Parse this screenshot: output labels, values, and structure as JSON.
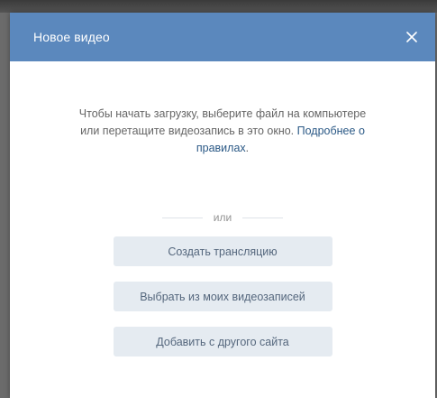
{
  "modal": {
    "title": "Новое видео",
    "close_icon": "close-icon",
    "description_text": "Чтобы начать загрузку, выберите файл на компьютере или перетащите видеозапись в это окно. ",
    "rules_link": "Подробнее о правилах",
    "description_end": ".",
    "divider_text": "или",
    "buttons": [
      {
        "label": "Создать трансляцию"
      },
      {
        "label": "Выбрать из моих видеозаписей"
      },
      {
        "label": "Добавить с другого сайта"
      }
    ]
  },
  "colors": {
    "header": "#5b88bd",
    "button_bg": "#e5ebf1",
    "button_text": "#55677d",
    "link": "#2a5885"
  }
}
